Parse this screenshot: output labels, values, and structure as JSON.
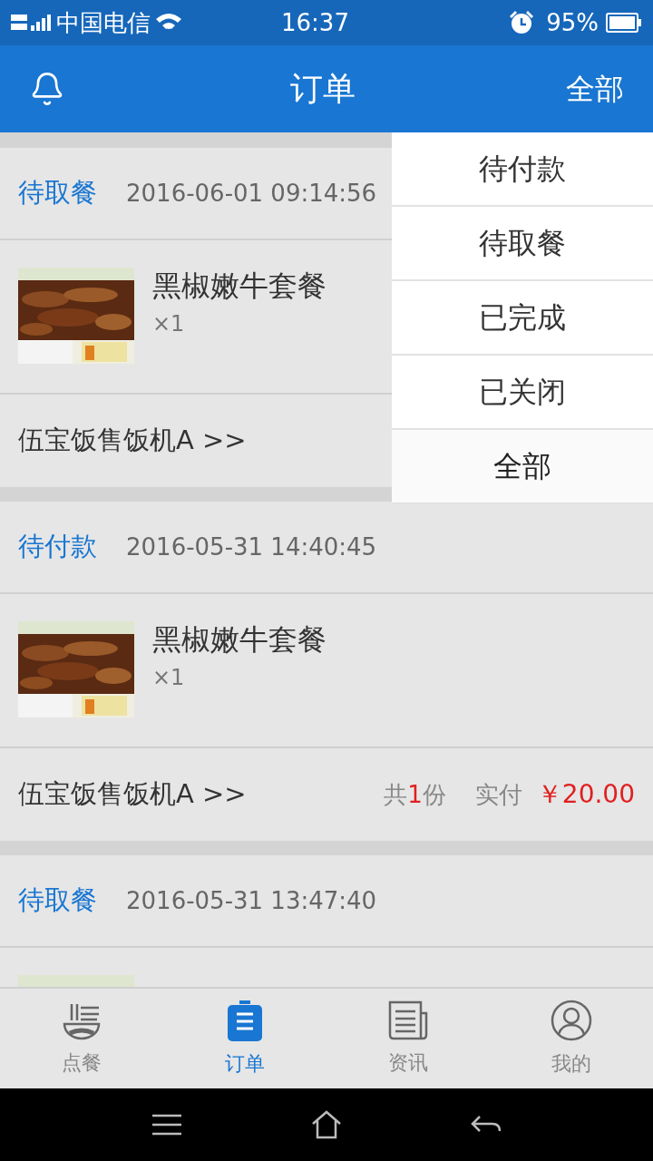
{
  "status_bar": {
    "carrier": "中国电信",
    "time": "16:37",
    "battery": "95%"
  },
  "header": {
    "title": "订单",
    "filter": "全部"
  },
  "filter_menu": {
    "items": [
      {
        "label": "待付款",
        "selected": false
      },
      {
        "label": "待取餐",
        "selected": false
      },
      {
        "label": "已完成",
        "selected": false
      },
      {
        "label": "已关闭",
        "selected": false
      },
      {
        "label": "全部",
        "selected": true
      }
    ]
  },
  "orders": [
    {
      "status": "待取餐",
      "date": "2016-06-01 09:14:56",
      "product": {
        "name": "黑椒嫩牛套餐",
        "quantity": "×1"
      },
      "footer": {
        "machine": "伍宝饭售饭机A >>"
      }
    },
    {
      "status": "待付款",
      "date": "2016-05-31 14:40:45",
      "product": {
        "name": "黑椒嫩牛套餐",
        "quantity": "×1"
      },
      "footer": {
        "machine": "伍宝饭售饭机A >>",
        "count_prefix": "共",
        "count": "1",
        "count_suffix": "份",
        "paid_label": "实付",
        "amount": "￥20.00"
      }
    },
    {
      "status": "待取餐",
      "date": "2016-05-31 13:47:40"
    }
  ],
  "tab_bar": [
    {
      "label": "点餐",
      "selected": false
    },
    {
      "label": "订单",
      "selected": true
    },
    {
      "label": "资讯",
      "selected": false
    },
    {
      "label": "我的",
      "selected": false
    }
  ]
}
